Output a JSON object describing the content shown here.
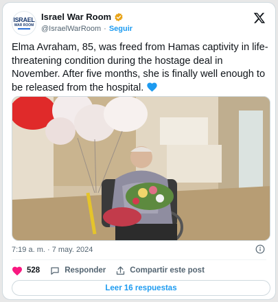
{
  "author": {
    "display_name": "Israel War Room",
    "handle": "@IsraelWarRoom",
    "separator": "·",
    "follow_label": "Seguir",
    "avatar_logo_top": "ISRAEL",
    "avatar_logo_bottom": "WAR ROOM",
    "verified_badge_color": "#e8a317"
  },
  "tweet": {
    "text": "Elma Avraham, 85, was freed from Hamas captivity in life-threatening condition during the hostage deal in November. After five months, she is finally well enough to be released from the hospital. ",
    "emoji": "💙",
    "timestamp": "7:19 a. m. · 7 may. 2024"
  },
  "media": {
    "alt_icon": "photo-icon"
  },
  "actions": {
    "like_count": "528",
    "reply_label": "Responder",
    "share_label": "Compartir este post",
    "like_color": "#f91880"
  },
  "footer": {
    "read_replies_label": "Leer 16 respuestas"
  },
  "colors": {
    "accent": "#1d9bf0",
    "secondary_text": "#536471",
    "border": "#cfd9de"
  }
}
